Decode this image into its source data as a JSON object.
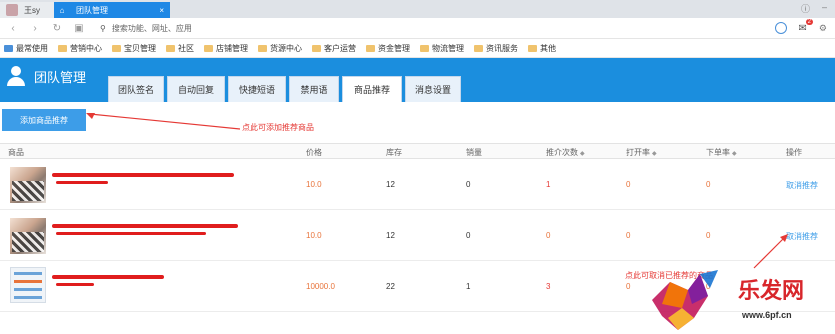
{
  "browser": {
    "user_tab": "王sy",
    "active_tab": "团队管理",
    "address_placeholder": "搜索功能、网址、应用",
    "mail_badge": "2",
    "bookmarks": [
      "最常使用",
      "营销中心",
      "宝贝管理",
      "社区",
      "店铺管理",
      "货源中心",
      "客户运营",
      "资金管理",
      "物流管理",
      "资讯服务",
      "其他"
    ]
  },
  "header": {
    "title": "团队管理",
    "tabs": [
      "团队签名",
      "自动回复",
      "快捷短语",
      "禁用语",
      "商品推荐",
      "消息设置"
    ],
    "active_tab_index": 4
  },
  "toolbar": {
    "add_button": "添加商品推荐",
    "annotation": "点此可添加推荐商品"
  },
  "table": {
    "headers": [
      "商品",
      "价格",
      "库存",
      "销量",
      "推介次数",
      "打开率",
      "下单率",
      "操作"
    ],
    "rows": [
      {
        "price": "10.0",
        "stock": "12",
        "sales": "0",
        "recommend": "1",
        "open_rate": "0",
        "order_rate": "0",
        "action": "取消推荐"
      },
      {
        "price": "10.0",
        "stock": "12",
        "sales": "0",
        "recommend": "0",
        "open_rate": "0",
        "order_rate": "0",
        "action": "取消推荐"
      },
      {
        "price": "10000.0",
        "stock": "22",
        "sales": "1",
        "recommend": "3",
        "open_rate": "0",
        "order_rate": "0",
        "action": ""
      }
    ]
  },
  "annotation2": "点此可取消已推荐的商品",
  "watermark": {
    "brand": "乐发网",
    "url": "www.6pf.cn"
  },
  "colors": {
    "primary": "#1b8ede",
    "button": "#3d9de8",
    "annotation": "#e53935",
    "price": "#e8743b"
  }
}
